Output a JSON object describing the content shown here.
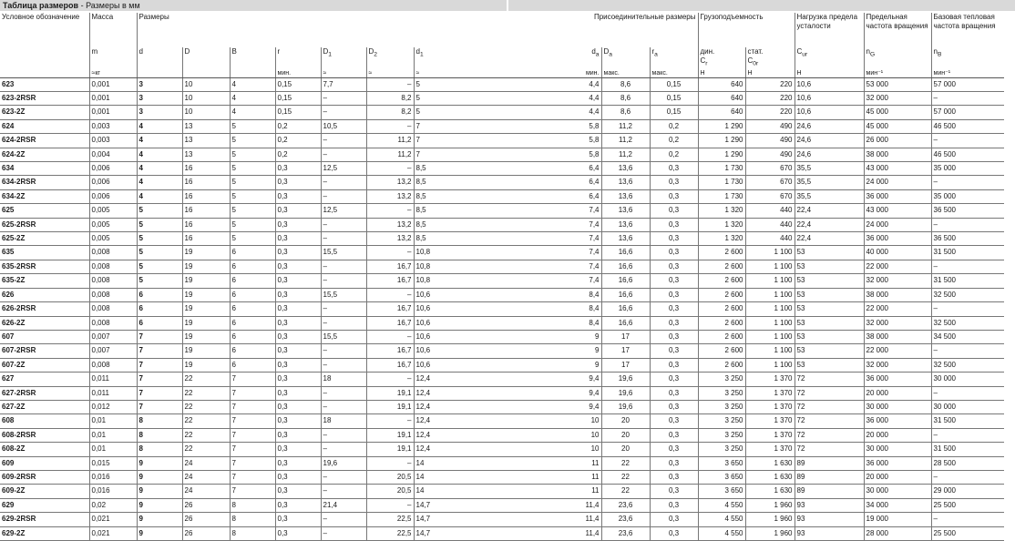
{
  "title": {
    "main": "Таблица размеров",
    "sub": " - Размеры в мм"
  },
  "headers": {
    "designation": "Условное обозначение",
    "mass": "Масса",
    "dims": "Размеры",
    "mounting": "Присоединительные размеры",
    "load": "Грузоподъемность",
    "fatigue": "Нагрузка предела усталости",
    "limit_speed": "Предельная частота вращения",
    "ref_speed": "Базовая тепловая частота вращения"
  },
  "symbols": {
    "m": "m",
    "d": "d",
    "D": "D",
    "B": "B",
    "r": "r",
    "D1": "D1",
    "D2": "D2",
    "d1": "d1",
    "da": "da",
    "Da": "Da",
    "ra": "ra",
    "Cr": "дин. Cr",
    "C0r": "стат. C0r",
    "Cur": "Cur",
    "nG": "nG",
    "nB": "nB"
  },
  "units": {
    "m": "≈кг",
    "r": "мин.",
    "D1": "≈",
    "D2": "≈",
    "d1": "≈",
    "da": "мин.",
    "Da": "макс.",
    "ra": "макс.",
    "Cr": "Н",
    "C0r": "Н",
    "Cur": "Н",
    "nG": "мин⁻¹",
    "nB": "мин⁻¹"
  },
  "rows": [
    [
      "623",
      "0,001",
      "3",
      "10",
      "4",
      "0,15",
      "7,7",
      "–",
      "5",
      "4,4",
      "8,6",
      "0,15",
      "640",
      "220",
      "10,6",
      "53 000",
      "57 000"
    ],
    [
      "623-2RSR",
      "0,001",
      "3",
      "10",
      "4",
      "0,15",
      "–",
      "8,2",
      "5",
      "4,4",
      "8,6",
      "0,15",
      "640",
      "220",
      "10,6",
      "32 000",
      "–"
    ],
    [
      "623-2Z",
      "0,001",
      "3",
      "10",
      "4",
      "0,15",
      "–",
      "8,2",
      "5",
      "4,4",
      "8,6",
      "0,15",
      "640",
      "220",
      "10,6",
      "45 000",
      "57 000"
    ],
    [
      "624",
      "0,003",
      "4",
      "13",
      "5",
      "0,2",
      "10,5",
      "–",
      "7",
      "5,8",
      "11,2",
      "0,2",
      "1 290",
      "490",
      "24,6",
      "45 000",
      "46 500"
    ],
    [
      "624-2RSR",
      "0,003",
      "4",
      "13",
      "5",
      "0,2",
      "–",
      "11,2",
      "7",
      "5,8",
      "11,2",
      "0,2",
      "1 290",
      "490",
      "24,6",
      "26 000",
      "–"
    ],
    [
      "624-2Z",
      "0,004",
      "4",
      "13",
      "5",
      "0,2",
      "–",
      "11,2",
      "7",
      "5,8",
      "11,2",
      "0,2",
      "1 290",
      "490",
      "24,6",
      "38 000",
      "46 500"
    ],
    [
      "634",
      "0,006",
      "4",
      "16",
      "5",
      "0,3",
      "12,5",
      "–",
      "8,5",
      "6,4",
      "13,6",
      "0,3",
      "1 730",
      "670",
      "35,5",
      "43 000",
      "35 000"
    ],
    [
      "634-2RSR",
      "0,006",
      "4",
      "16",
      "5",
      "0,3",
      "–",
      "13,2",
      "8,5",
      "6,4",
      "13,6",
      "0,3",
      "1 730",
      "670",
      "35,5",
      "24 000",
      "–"
    ],
    [
      "634-2Z",
      "0,006",
      "4",
      "16",
      "5",
      "0,3",
      "–",
      "13,2",
      "8,5",
      "6,4",
      "13,6",
      "0,3",
      "1 730",
      "670",
      "35,5",
      "36 000",
      "35 000"
    ],
    [
      "625",
      "0,005",
      "5",
      "16",
      "5",
      "0,3",
      "12,5",
      "–",
      "8,5",
      "7,4",
      "13,6",
      "0,3",
      "1 320",
      "440",
      "22,4",
      "43 000",
      "36 500"
    ],
    [
      "625-2RSR",
      "0,005",
      "5",
      "16",
      "5",
      "0,3",
      "–",
      "13,2",
      "8,5",
      "7,4",
      "13,6",
      "0,3",
      "1 320",
      "440",
      "22,4",
      "24 000",
      "–"
    ],
    [
      "625-2Z",
      "0,005",
      "5",
      "16",
      "5",
      "0,3",
      "–",
      "13,2",
      "8,5",
      "7,4",
      "13,6",
      "0,3",
      "1 320",
      "440",
      "22,4",
      "36 000",
      "36 500"
    ],
    [
      "635",
      "0,008",
      "5",
      "19",
      "6",
      "0,3",
      "15,5",
      "–",
      "10,8",
      "7,4",
      "16,6",
      "0,3",
      "2 600",
      "1 100",
      "53",
      "40 000",
      "31 500"
    ],
    [
      "635-2RSR",
      "0,008",
      "5",
      "19",
      "6",
      "0,3",
      "–",
      "16,7",
      "10,8",
      "7,4",
      "16,6",
      "0,3",
      "2 600",
      "1 100",
      "53",
      "22 000",
      "–"
    ],
    [
      "635-2Z",
      "0,008",
      "5",
      "19",
      "6",
      "0,3",
      "–",
      "16,7",
      "10,8",
      "7,4",
      "16,6",
      "0,3",
      "2 600",
      "1 100",
      "53",
      "32 000",
      "31 500"
    ],
    [
      "626",
      "0,008",
      "6",
      "19",
      "6",
      "0,3",
      "15,5",
      "–",
      "10,6",
      "8,4",
      "16,6",
      "0,3",
      "2 600",
      "1 100",
      "53",
      "38 000",
      "32 500"
    ],
    [
      "626-2RSR",
      "0,008",
      "6",
      "19",
      "6",
      "0,3",
      "–",
      "16,7",
      "10,6",
      "8,4",
      "16,6",
      "0,3",
      "2 600",
      "1 100",
      "53",
      "22 000",
      "–"
    ],
    [
      "626-2Z",
      "0,008",
      "6",
      "19",
      "6",
      "0,3",
      "–",
      "16,7",
      "10,6",
      "8,4",
      "16,6",
      "0,3",
      "2 600",
      "1 100",
      "53",
      "32 000",
      "32 500"
    ],
    [
      "607",
      "0,007",
      "7",
      "19",
      "6",
      "0,3",
      "15,5",
      "–",
      "10,6",
      "9",
      "17",
      "0,3",
      "2 600",
      "1 100",
      "53",
      "38 000",
      "34 500"
    ],
    [
      "607-2RSR",
      "0,007",
      "7",
      "19",
      "6",
      "0,3",
      "–",
      "16,7",
      "10,6",
      "9",
      "17",
      "0,3",
      "2 600",
      "1 100",
      "53",
      "22 000",
      "–"
    ],
    [
      "607-2Z",
      "0,008",
      "7",
      "19",
      "6",
      "0,3",
      "–",
      "16,7",
      "10,6",
      "9",
      "17",
      "0,3",
      "2 600",
      "1 100",
      "53",
      "32 000",
      "32 500"
    ],
    [
      "627",
      "0,011",
      "7",
      "22",
      "7",
      "0,3",
      "18",
      "–",
      "12,4",
      "9,4",
      "19,6",
      "0,3",
      "3 250",
      "1 370",
      "72",
      "36 000",
      "30 000"
    ],
    [
      "627-2RSR",
      "0,011",
      "7",
      "22",
      "7",
      "0,3",
      "–",
      "19,1",
      "12,4",
      "9,4",
      "19,6",
      "0,3",
      "3 250",
      "1 370",
      "72",
      "20 000",
      "–"
    ],
    [
      "627-2Z",
      "0,012",
      "7",
      "22",
      "7",
      "0,3",
      "–",
      "19,1",
      "12,4",
      "9,4",
      "19,6",
      "0,3",
      "3 250",
      "1 370",
      "72",
      "30 000",
      "30 000"
    ],
    [
      "608",
      "0,01",
      "8",
      "22",
      "7",
      "0,3",
      "18",
      "–",
      "12,4",
      "10",
      "20",
      "0,3",
      "3 250",
      "1 370",
      "72",
      "36 000",
      "31 500"
    ],
    [
      "608-2RSR",
      "0,01",
      "8",
      "22",
      "7",
      "0,3",
      "–",
      "19,1",
      "12,4",
      "10",
      "20",
      "0,3",
      "3 250",
      "1 370",
      "72",
      "20 000",
      "–"
    ],
    [
      "608-2Z",
      "0,01",
      "8",
      "22",
      "7",
      "0,3",
      "–",
      "19,1",
      "12,4",
      "10",
      "20",
      "0,3",
      "3 250",
      "1 370",
      "72",
      "30 000",
      "31 500"
    ],
    [
      "609",
      "0,015",
      "9",
      "24",
      "7",
      "0,3",
      "19,6",
      "–",
      "14",
      "11",
      "22",
      "0,3",
      "3 650",
      "1 630",
      "89",
      "36 000",
      "28 500"
    ],
    [
      "609-2RSR",
      "0,016",
      "9",
      "24",
      "7",
      "0,3",
      "–",
      "20,5",
      "14",
      "11",
      "22",
      "0,3",
      "3 650",
      "1 630",
      "89",
      "20 000",
      "–"
    ],
    [
      "609-2Z",
      "0,016",
      "9",
      "24",
      "7",
      "0,3",
      "–",
      "20,5",
      "14",
      "11",
      "22",
      "0,3",
      "3 650",
      "1 630",
      "89",
      "30 000",
      "29 000"
    ],
    [
      "629",
      "0,02",
      "9",
      "26",
      "8",
      "0,3",
      "21,4",
      "–",
      "14,7",
      "11,4",
      "23,6",
      "0,3",
      "4 550",
      "1 960",
      "93",
      "34 000",
      "25 500"
    ],
    [
      "629-2RSR",
      "0,021",
      "9",
      "26",
      "8",
      "0,3",
      "–",
      "22,5",
      "14,7",
      "11,4",
      "23,6",
      "0,3",
      "4 550",
      "1 960",
      "93",
      "19 000",
      "–"
    ],
    [
      "629-2Z",
      "0,021",
      "9",
      "26",
      "8",
      "0,3",
      "–",
      "22,5",
      "14,7",
      "11,4",
      "23,6",
      "0,3",
      "4 550",
      "1 960",
      "93",
      "28 000",
      "25 500"
    ]
  ]
}
